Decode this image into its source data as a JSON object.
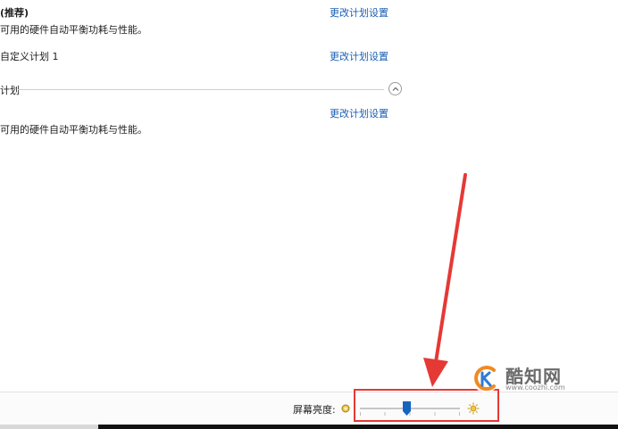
{
  "plans": [
    {
      "title": "(推荐)",
      "description": "可用的硬件自动平衡功耗与性能。",
      "change_link": "更改计划设置"
    },
    {
      "title": "自定义计划 1",
      "change_link": "更改计划设置"
    }
  ],
  "hidden_section": {
    "label": "计划",
    "change_link": "更改计划设置",
    "description": "可用的硬件自动平衡功耗与性能。"
  },
  "footer": {
    "brightness_label": "屏幕亮度:",
    "brightness_level": 0.47
  },
  "watermark": {
    "name": "酷知网",
    "url": "www.coozhi.com"
  },
  "colors": {
    "link": "#1a5fb4",
    "highlight": "#e53935",
    "slider_thumb": "#1565c0"
  },
  "icons": {
    "collapse": "chevron-up-icon",
    "brightness_low": "sun-small-icon",
    "brightness_high": "sun-large-icon"
  }
}
